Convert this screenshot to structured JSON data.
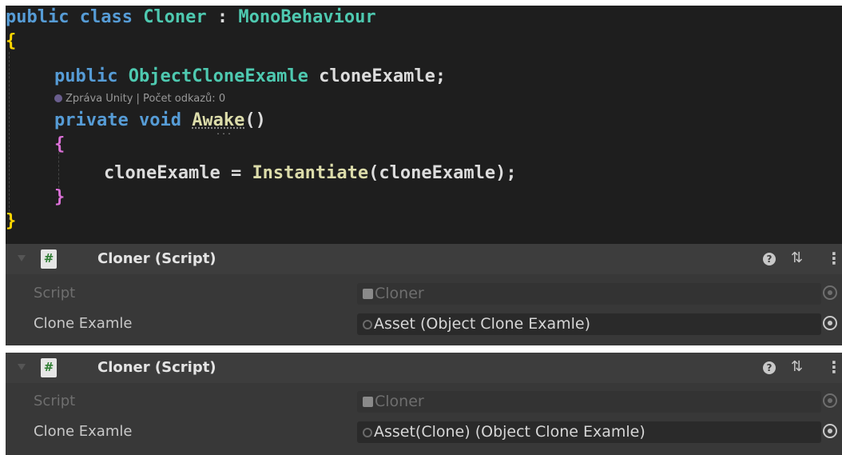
{
  "editor": {
    "lines": {
      "l1": {
        "kw": "public class ",
        "type": "Cloner",
        "colon": " : ",
        "base": "MonoBehaviour"
      },
      "l2": {
        "brace": "{"
      },
      "l3": {
        "kw": "public ",
        "type": "ObjectCloneExamle",
        "rest": " cloneExamle;"
      },
      "l4": {
        "kw": "private void ",
        "method": "Awake",
        "paren": "()"
      },
      "l5": {
        "brace": "{"
      },
      "l6": {
        "lhs": "cloneExamle = ",
        "method": "Instantiate",
        "args": "(cloneExamle);"
      },
      "l7": {
        "brace": "}"
      },
      "l8": {
        "brace": "}"
      }
    },
    "codelens": "Zpráva Unity | Počet odkazů: 0",
    "codelens_icon": "unity-icon",
    "suggestion_dots": "...",
    "colors": {
      "keyword": "#569cd6",
      "type": "#4ec9b0",
      "method": "#dcdcaa",
      "text": "#dcdcdc",
      "background": "#1e1e1e"
    }
  },
  "components": [
    {
      "title": "Cloner (Script)",
      "file_icon": "#",
      "help_icon": "?",
      "presets_icon": "⇅",
      "menu_icon": "⋮",
      "props": [
        {
          "label": "Script",
          "value": "Cloner",
          "icon": "script-icon",
          "disabled": true
        },
        {
          "label": "Clone Examle",
          "value": "Asset (Object Clone Examle)",
          "icon": "asset-icon",
          "disabled": false
        }
      ]
    },
    {
      "title": "Cloner (Script)",
      "file_icon": "#",
      "help_icon": "?",
      "presets_icon": "⇅",
      "menu_icon": "⋮",
      "props": [
        {
          "label": "Script",
          "value": "Cloner",
          "icon": "script-icon",
          "disabled": true
        },
        {
          "label": "Clone Examle",
          "value": "Asset(Clone) (Object Clone Examle)",
          "icon": "asset-icon",
          "disabled": false
        }
      ]
    }
  ]
}
